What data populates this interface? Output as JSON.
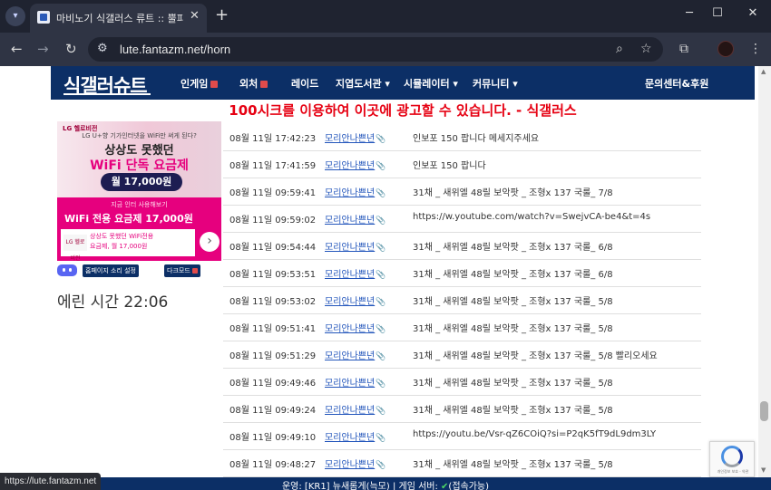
{
  "browser": {
    "tab_title": "마비노기 식갤러스 류트 :: 뿔피리",
    "tab_close": "✕",
    "new_tab": "+",
    "url": "lute.fantazm.net/horn",
    "status_url": "https://lute.fantazm.net",
    "icons": [
      "search-tabs-icon",
      "back-icon",
      "forward-icon",
      "reload-icon",
      "site-info-icon",
      "zoom-icon",
      "bookmark-star-icon",
      "extensions-icon",
      "profile-avatar",
      "menu-icon",
      "minimize-icon",
      "maximize-icon",
      "close-window-icon"
    ]
  },
  "site": {
    "logo": "식갤러슈트",
    "nav": [
      {
        "label": "인게임",
        "new": true
      },
      {
        "label": "외처",
        "new": true
      },
      {
        "label": "레이드",
        "new": false
      },
      {
        "label": "지엽도서관 ▾",
        "new": false
      },
      {
        "label": "시뮬레이터 ▾",
        "new": false
      },
      {
        "label": "커뮤니티 ▾",
        "new": false
      }
    ],
    "contact": "문의센터&후원",
    "ad_line": "100시크를 이용하여 이곳에 광고할 수 있습니다. - 식갤러스"
  },
  "ad": {
    "brand": "LG 헬로비전",
    "small": "LG U+향 기가인터넷을 WiFi만 써게 된다?",
    "head1": "상상도 못했던",
    "head2": "WiFi 단독 요금제",
    "price": "월 17,000원",
    "tiny": "지금 인터 사용해보기",
    "main": "WiFi 전용 요금제 17,000원",
    "card_logo": "LG 헬로비전",
    "card_line1": "상상도 못했던 WiFi전용",
    "card_line2": "요금제, 월 17,000원",
    "arrow": "›"
  },
  "sidebar": {
    "sound_button": "홈페이지 소리 설정",
    "dark_button": "다크모드",
    "erin_time": "에린 시간 22:06"
  },
  "horn_rows": [
    {
      "time": "08월 11일 17:42:23",
      "user": "모리안나쁜년",
      "msg": "인보포 150 팝니다 메세지주세요"
    },
    {
      "time": "08월 11일 17:41:59",
      "user": "모리안나쁜년",
      "msg": "인보포 150 팝니다"
    },
    {
      "time": "08월 11일 09:59:41",
      "user": "모리안나쁜년",
      "msg": "31채 _ 새위엘 48릴 보악팟 _ 조형x 137 국룰_ 7/8"
    },
    {
      "time": "08월 11일 09:59:02",
      "user": "모리안나쁜년",
      "msg": "https://w.youtube.com/watch?v=SwejvCA-be4&t=4s"
    },
    {
      "time": "08월 11일 09:54:44",
      "user": "모리안나쁜년",
      "msg": "31채 _ 새위엘 48릴 보악팟 _ 조형x 137 국룰_ 6/8"
    },
    {
      "time": "08월 11일 09:53:51",
      "user": "모리안나쁜년",
      "msg": "31채 _ 새위엘 48릴 보악팟 _ 조형x 137 국룰_ 6/8"
    },
    {
      "time": "08월 11일 09:53:02",
      "user": "모리안나쁜년",
      "msg": "31채 _ 새위엘 48릴 보악팟 _ 조형x 137 국룰_ 5/8"
    },
    {
      "time": "08월 11일 09:51:41",
      "user": "모리안나쁜년",
      "msg": "31채 _ 새위엘 48릴 보악팟 _ 조형x 137 국룰_ 5/8"
    },
    {
      "time": "08월 11일 09:51:29",
      "user": "모리안나쁜년",
      "msg": "31채 _ 새위엘 48릴 보악팟 _ 조형x 137 국룰_ 5/8 빨리오세요"
    },
    {
      "time": "08월 11일 09:49:46",
      "user": "모리안나쁜년",
      "msg": "31채 _ 새위엘 48릴 보악팟 _ 조형x 137 국룰_ 5/8"
    },
    {
      "time": "08월 11일 09:49:24",
      "user": "모리안나쁜년",
      "msg": "31채 _ 새위엘 48릴 보악팟 _ 조형x 137 국룰_ 5/8"
    },
    {
      "time": "08월 11일 09:49:10",
      "user": "모리안나쁜년",
      "msg": "https://youtu.be/Vsr-qZ6COiQ?si=P2qK5fT9dL9dm3LY"
    },
    {
      "time": "08월 11일 09:48:27",
      "user": "모리안나쁜년",
      "msg": "31채 _ 새위엘 48릴 보악팟 _ 조형x 137 국룰_ 5/8"
    }
  ],
  "status": {
    "text_before": "운영: [KR1] 뉴새롬게(늑모)   |  게임 서버: ",
    "check": "✔",
    "text_after": "(접속가능)"
  },
  "recaptcha": {
    "label": "개인정보 보호 - 약관"
  },
  "colors": {
    "site_navy": "#0c2f66",
    "ad_red": "#e60012",
    "ad_pink": "#e6007e",
    "link_blue": "#2255bb"
  }
}
